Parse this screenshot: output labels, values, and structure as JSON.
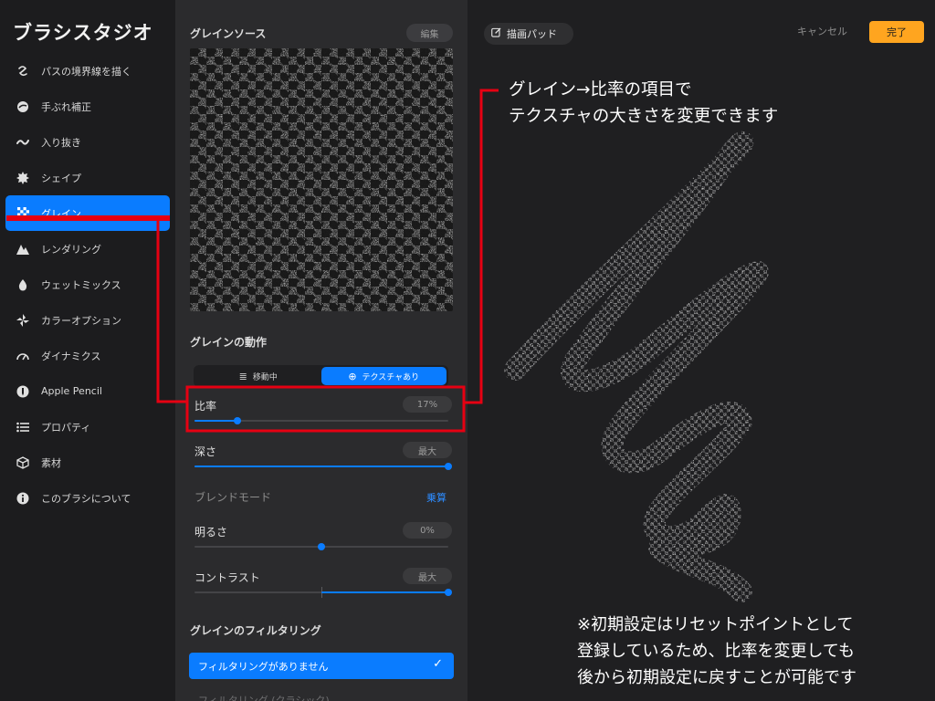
{
  "app_title": "ブラシスタジオ",
  "sidebar": {
    "items": [
      {
        "label": "パスの境界線を描く",
        "icon": "path-curve-icon"
      },
      {
        "label": "手ぶれ補正",
        "icon": "stabilize-icon"
      },
      {
        "label": "入り抜き",
        "icon": "taper-wave-icon"
      },
      {
        "label": "シェイプ",
        "icon": "shape-gear-icon"
      },
      {
        "label": "グレイン",
        "icon": "grain-checker-icon",
        "active": true
      },
      {
        "label": "レンダリング",
        "icon": "rendering-mountain-icon"
      },
      {
        "label": "ウェットミックス",
        "icon": "wet-drop-icon"
      },
      {
        "label": "カラーオプション",
        "icon": "color-pinwheel-icon"
      },
      {
        "label": "ダイナミクス",
        "icon": "dynamics-gauge-icon"
      },
      {
        "label": "Apple Pencil",
        "icon": "apple-pencil-icon"
      },
      {
        "label": "プロパティ",
        "icon": "properties-list-icon"
      },
      {
        "label": "素材",
        "icon": "material-cube-icon"
      },
      {
        "label": "このブラシについて",
        "icon": "info-icon"
      }
    ]
  },
  "panel": {
    "grain_source": {
      "header": "グレインソース",
      "edit_label": "編集"
    },
    "grain_behavior": {
      "header": "グレインの動作",
      "segments": [
        {
          "label": "移動中",
          "icon": "moving-stack-icon",
          "active": false
        },
        {
          "label": "テクスチャあり",
          "icon": "texture-globe-icon",
          "active": true
        }
      ]
    },
    "settings": {
      "scale": {
        "label": "比率",
        "value": "17%",
        "level": 0.17
      },
      "depth": {
        "label": "深さ",
        "value": "最大",
        "level": 1.0
      },
      "blend_mode": {
        "label": "ブレンドモード",
        "value": "乗算"
      },
      "brightness": {
        "label": "明るさ",
        "value": "0%",
        "level": 0.5
      },
      "contrast": {
        "label": "コントラスト",
        "value": "最大",
        "level": 1.0
      }
    },
    "filtering": {
      "header": "グレインのフィルタリング",
      "options": [
        {
          "label": "フィルタリングがありません",
          "selected": true
        },
        {
          "label": "フィルタリング (クラシック)",
          "selected": false
        }
      ]
    }
  },
  "pad": {
    "drawing_pad_label": "描画パッド",
    "cancel_label": "キャンセル",
    "done_label": "完了"
  },
  "annotations": {
    "top_line1": "グレイン→比率の項目で",
    "top_line2": "テクスチャの大きさを変更できます",
    "bottom_line1": "※初期設定はリセットポイントとして",
    "bottom_line2": "登録しているため、比率を変更しても",
    "bottom_line3": "後から初期設定に戻すことが可能です"
  },
  "colors": {
    "accent": "#0a7cff",
    "done": "#ffa51f",
    "annotation": "#e60012",
    "panel_bg": "#2b2b2d",
    "sidebar_bg": "#1c1c1e"
  }
}
